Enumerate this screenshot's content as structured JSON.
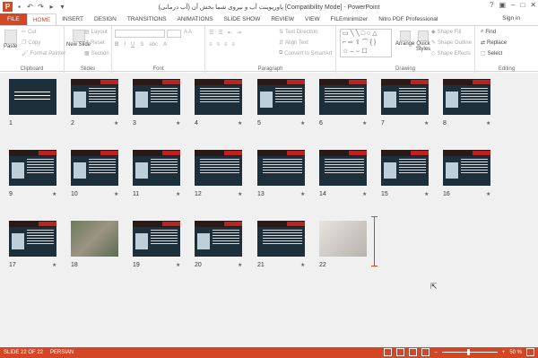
{
  "app": {
    "title": "پاورپوینت آب و نیروی شما بخش آن (آب درمانی) [Compatibility Mode] - PowerPoint",
    "sign_in": "Sign in"
  },
  "tabs": [
    "FILE",
    "HOME",
    "INSERT",
    "DESIGN",
    "TRANSITIONS",
    "ANIMATIONS",
    "SLIDE SHOW",
    "REVIEW",
    "VIEW",
    "FILEminimizer",
    "Nitro PDF Professional"
  ],
  "ribbon": {
    "clipboard": {
      "label": "Clipboard",
      "paste": "Paste",
      "cut": "Cut",
      "copy": "Copy",
      "format_painter": "Format Painter"
    },
    "slides": {
      "label": "Slides",
      "new_slide": "New Slide",
      "layout": "Layout",
      "reset": "Reset",
      "section": "Section"
    },
    "font": {
      "label": "Font"
    },
    "paragraph": {
      "label": "Paragraph",
      "text_direction": "Text Direction",
      "align_text": "Align Text",
      "convert_smartart": "Convert to SmartArt"
    },
    "drawing": {
      "label": "Drawing",
      "arrange": "Arrange",
      "quick_styles": "Quick Styles",
      "shape_fill": "Shape Fill",
      "shape_outline": "Shape Outline",
      "shape_effects": "Shape Effects"
    },
    "editing": {
      "label": "Editing",
      "find": "Find",
      "replace": "Replace",
      "select": "Select"
    }
  },
  "slides": [
    {
      "num": "1",
      "kind": "title"
    },
    {
      "num": "2",
      "kind": "pic"
    },
    {
      "num": "3",
      "kind": "pic"
    },
    {
      "num": "4",
      "kind": "text"
    },
    {
      "num": "5",
      "kind": "pic"
    },
    {
      "num": "6",
      "kind": "text"
    },
    {
      "num": "7",
      "kind": "pic"
    },
    {
      "num": "8",
      "kind": "pic"
    },
    {
      "num": "9",
      "kind": "pic"
    },
    {
      "num": "10",
      "kind": "pic"
    },
    {
      "num": "11",
      "kind": "pic"
    },
    {
      "num": "12",
      "kind": "text"
    },
    {
      "num": "13",
      "kind": "text"
    },
    {
      "num": "14",
      "kind": "text"
    },
    {
      "num": "15",
      "kind": "pic"
    },
    {
      "num": "16",
      "kind": "pic"
    },
    {
      "num": "17",
      "kind": "pic"
    },
    {
      "num": "18",
      "kind": "photo"
    },
    {
      "num": "19",
      "kind": "pic"
    },
    {
      "num": "20",
      "kind": "pic"
    },
    {
      "num": "21",
      "kind": "text"
    },
    {
      "num": "22",
      "kind": "laptop"
    }
  ],
  "status": {
    "slide": "SLIDE 22 OF 22",
    "language": "PERSIAN",
    "zoom": "50 %"
  }
}
